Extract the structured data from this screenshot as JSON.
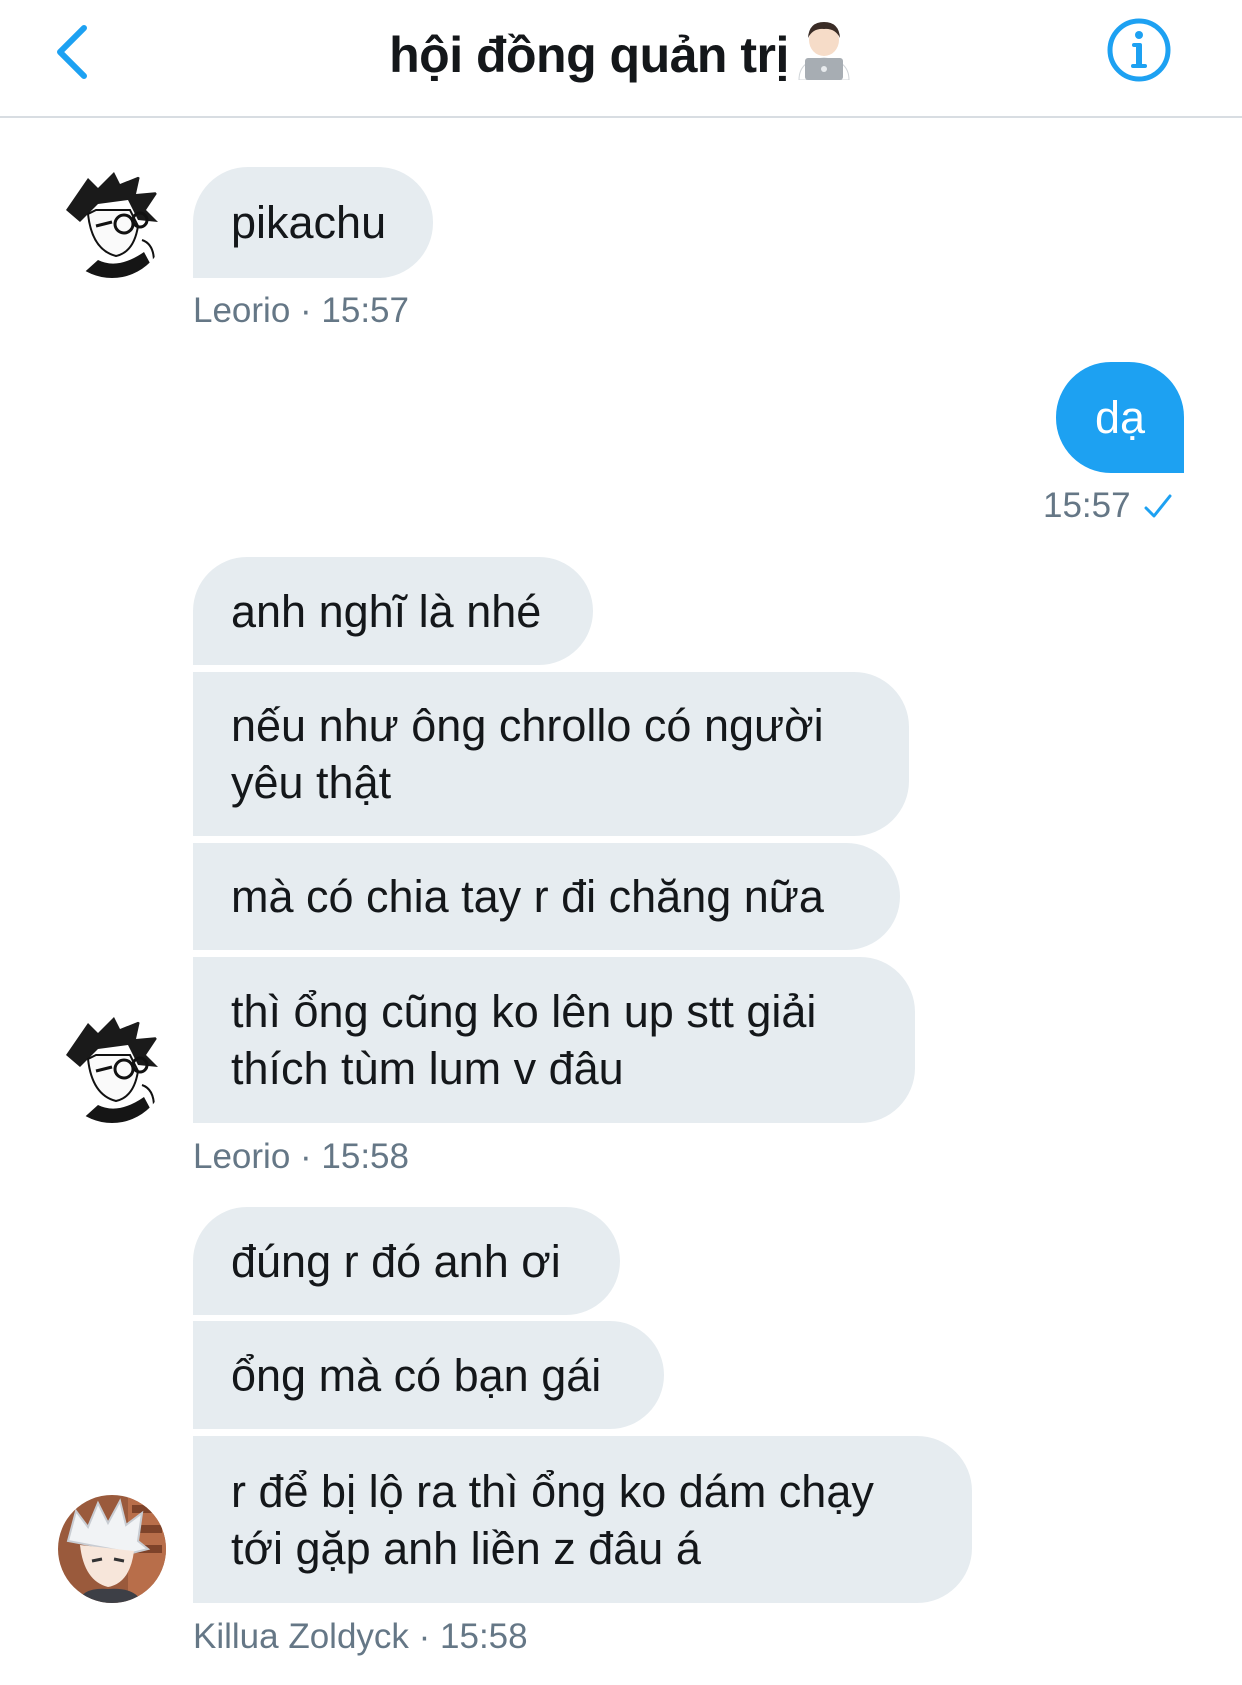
{
  "header": {
    "title": "hội đồng quản trị",
    "back_icon": "chevron-left-icon",
    "info_icon": "info-icon",
    "title_emoji": "technologist-emoji",
    "accent": "#1da1f2"
  },
  "messages": {
    "m1": {
      "text": "pikachu",
      "meta": "Leorio · 15:57"
    },
    "out1": {
      "text": "dạ",
      "meta": "15:57"
    },
    "g2": {
      "b1": "anh nghĩ là nhé",
      "b2_l1": "nếu như ông chrollo có người",
      "b2_l2": "yêu thật",
      "b3": "mà có chia tay r đi chăng nữa",
      "b4_l1": "thì ổng cũng ko lên up stt giải",
      "b4_l2": "thích tùm lum v đâu",
      "meta": "Leorio · 15:58"
    },
    "g3": {
      "b1": "đúng r đó anh ơi",
      "b2": "ổng mà có bạn gái",
      "b3_l1": "r để bị lộ ra thì ổng ko dám chạy",
      "b3_l2": "tới gặp anh liền z đâu á",
      "meta": "Killua Zoldyck · 15:58"
    }
  },
  "colors": {
    "bubble_in": "#e6ecf0",
    "bubble_out": "#1da1f2",
    "meta_text": "#657786"
  }
}
